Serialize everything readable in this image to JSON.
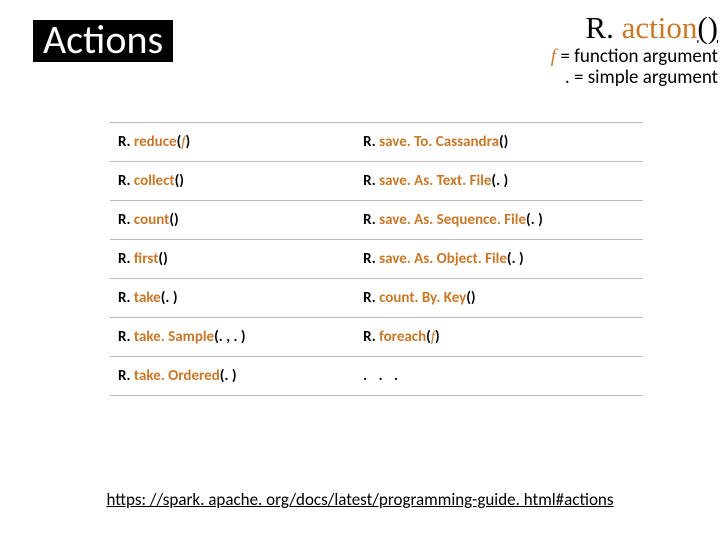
{
  "title": "Actions",
  "header": {
    "prefix": "R. ",
    "accent": "action",
    "underlined": "()"
  },
  "legend": {
    "f_symbol": "f",
    "f_text": "= function argument",
    "dot_symbol": ".",
    "dot_text": "= simple argument"
  },
  "rows": [
    {
      "a": {
        "prefix": "R. ",
        "method": "reduce",
        "farg": "f"
      },
      "b": {
        "prefix": "R. ",
        "method": "save. To. Cassandra"
      }
    },
    {
      "a": {
        "prefix": "R. ",
        "method": "collect"
      },
      "b": {
        "prefix": "R. ",
        "method": "save. As. Text. File",
        "dotarg": ". "
      }
    },
    {
      "a": {
        "prefix": "R. ",
        "method": "count"
      },
      "b": {
        "prefix": "R. ",
        "method": "save. As. Sequence. File",
        "dotarg": ". "
      }
    },
    {
      "a": {
        "prefix": "R. ",
        "method": "first"
      },
      "b": {
        "prefix": "R. ",
        "method": "save. As. Object. File",
        "dotarg": ". "
      }
    },
    {
      "a": {
        "prefix": "R. ",
        "method": "take",
        "dotarg": ". "
      },
      "b": {
        "prefix": "R. ",
        "method": "count. By. Key"
      }
    },
    {
      "a": {
        "prefix": "R. ",
        "method": "take. Sample",
        "dotarg": ". , . "
      },
      "b": {
        "prefix": "R. ",
        "method": "foreach",
        "farg": "f"
      }
    },
    {
      "a": {
        "prefix": "R. ",
        "method": "take. Ordered",
        "dotarg": ". "
      },
      "b": {
        "ellipsis": ". . ."
      }
    }
  ],
  "footer": {
    "link_text": "https: //spark. apache. org/docs/latest/programming-guide. html#actions"
  }
}
